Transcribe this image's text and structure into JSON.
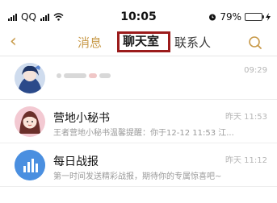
{
  "status_bar": {
    "carrier": "QQ",
    "time": "10:05",
    "battery_percent": "79%",
    "battery_level": 0.79
  },
  "nav": {
    "back_icon": "chevron-left-icon",
    "tabs": [
      {
        "label": "消息",
        "active": false
      },
      {
        "label": "聊天室",
        "active": true
      },
      {
        "label": "联系人",
        "active": false
      }
    ],
    "search_icon": "search-icon",
    "accent": "#c89a4a",
    "highlight": "#9b1b1b"
  },
  "conversations": [
    {
      "title": "",
      "time": "09:29",
      "preview": ""
    },
    {
      "title": "营地小秘书",
      "time": "昨天 11:53",
      "preview": "王者营地小秘书温馨提醒：你于12-12 11:53 江..."
    },
    {
      "title": "每日战报",
      "time": "昨天 11:12",
      "preview": "第一时间发送精彩战报，期待你的专属惊喜吧~"
    }
  ]
}
